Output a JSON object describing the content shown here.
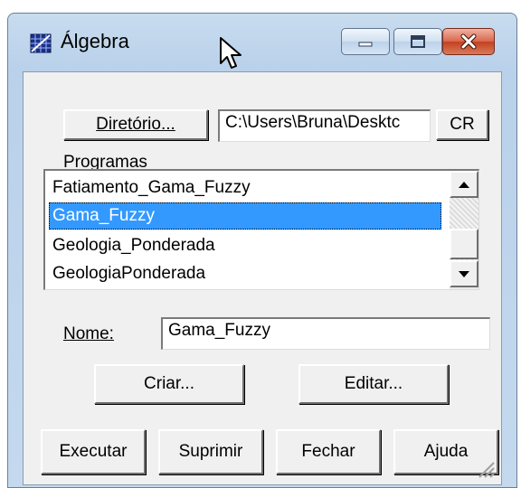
{
  "window": {
    "title": "Álgebra",
    "controls": {
      "minimize": "minimize-icon",
      "maximize": "maximize-icon",
      "close": "close-icon"
    }
  },
  "directory": {
    "button_label": "Diretório...",
    "button_underline": "D",
    "path_value": "C:\\Users\\Bruna\\Desktc",
    "cr_label": "CR",
    "cr_underline": "R"
  },
  "programs": {
    "label": "Programas",
    "items": [
      {
        "label": "Fatiamento_Gama_Fuzzy",
        "selected": false
      },
      {
        "label": "Gama_Fuzzy",
        "selected": true
      },
      {
        "label": "Geologia_Ponderada",
        "selected": false
      },
      {
        "label": "GeologiaPonderada",
        "selected": false
      }
    ]
  },
  "name_field": {
    "label": "Nome:",
    "value": "Gama_Fuzzy"
  },
  "actions": {
    "create_label": "Criar...",
    "edit_label": "Editar..."
  },
  "footer": {
    "execute_label": "Executar",
    "delete_label": "Suprimir",
    "close_label": "Fechar",
    "help_label": "Ajuda"
  },
  "colors": {
    "selection": "#3399ff",
    "close_button": "#c4411f",
    "title_gradient": "#b9d1ea"
  }
}
